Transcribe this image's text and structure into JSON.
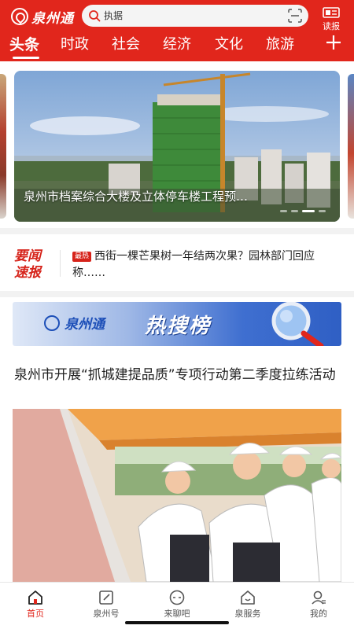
{
  "header": {
    "logo_text": "泉州通",
    "search_text": "执据",
    "read_label": "读报",
    "colors": {
      "brand_red": "#e1261c"
    }
  },
  "tabs": [
    {
      "label": "头条",
      "active": true
    },
    {
      "label": "时政",
      "active": false
    },
    {
      "label": "社会",
      "active": false
    },
    {
      "label": "经济",
      "active": false
    },
    {
      "label": "文化",
      "active": false
    },
    {
      "label": "旅游",
      "active": false
    }
  ],
  "banner": {
    "caption": "泉州市档案综合大楼及立体停车楼工程预…",
    "slide_count": 4,
    "active_slide": 2
  },
  "flash": {
    "logo_line1": "要闻",
    "logo_line2": "速报",
    "tag": "最热",
    "text": "西街一棵芒果树一年结两次果？园林部门回应称……"
  },
  "hot_search": {
    "logo_text": "泉州通",
    "title": "热搜榜"
  },
  "article": {
    "title": "泉州市开展“抓城建提品质”专项行动第二季度拉练活动"
  },
  "bottom_nav": [
    {
      "label": "首页",
      "icon": "home-icon",
      "active": true
    },
    {
      "label": "泉州号",
      "icon": "edit-icon",
      "active": false
    },
    {
      "label": "来聊吧",
      "icon": "chat-24-icon",
      "active": false
    },
    {
      "label": "泉服务",
      "icon": "service-icon",
      "active": false
    },
    {
      "label": "我的",
      "icon": "profile-icon",
      "active": false
    }
  ]
}
